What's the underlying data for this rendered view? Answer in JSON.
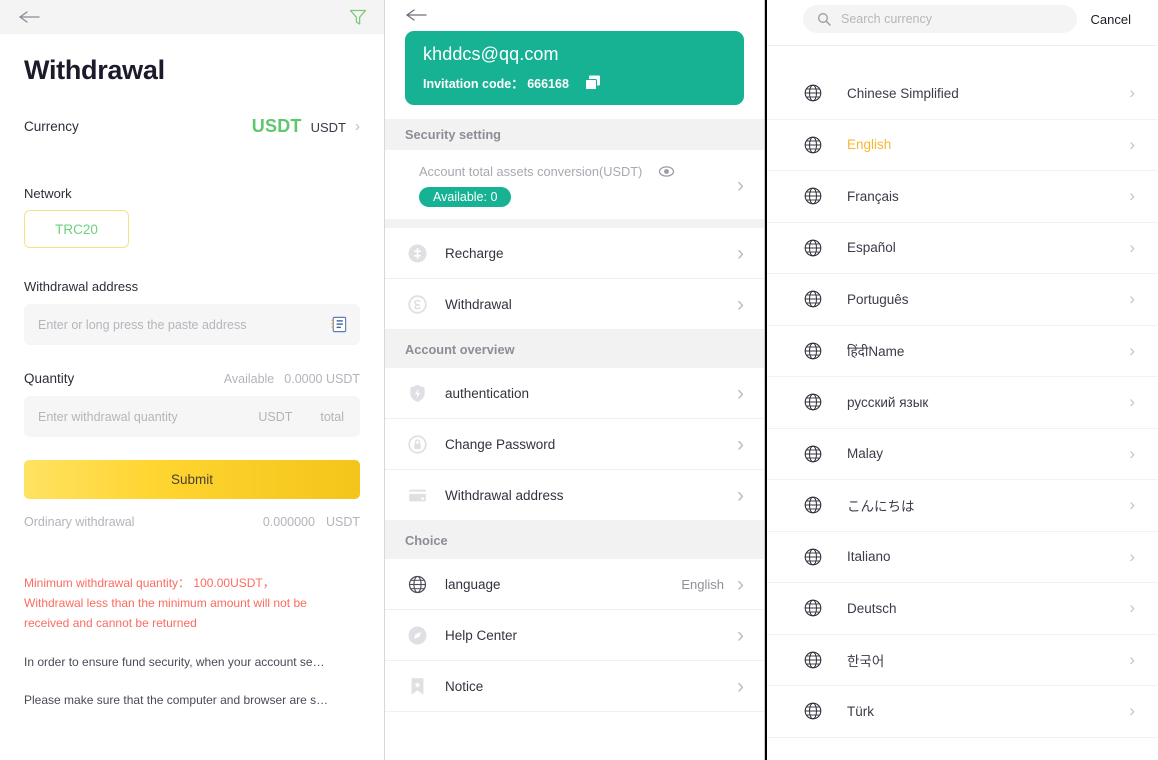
{
  "withdrawal_panel": {
    "topbar": {
      "back_icon": "back-arrow-icon",
      "filter_icon": "filter-icon"
    },
    "title": "Withdrawal",
    "currency": {
      "label": "Currency",
      "main_value": "USDT",
      "sub_value": "USDT",
      "chevron": "›"
    },
    "network": {
      "label": "Network",
      "selected": "TRC20"
    },
    "address": {
      "label": "Withdrawal address",
      "placeholder": "Enter or long press the paste address",
      "icon": "address-book-icon"
    },
    "quantity": {
      "label": "Quantity",
      "available_label": "Available",
      "available_value": "0.0000 USDT",
      "placeholder": "Enter withdrawal quantity",
      "unit": "USDT",
      "total_label": "total"
    },
    "submit_label": "Submit",
    "ordinary": {
      "label": "Ordinary withdrawal",
      "value": "0.000000",
      "unit": "USDT"
    },
    "warnings": {
      "red_line1": "Minimum withdrawal quantity： 100.00USDT，",
      "red_line2": "Withdrawal less than the minimum amount will not be",
      "red_line3": "received and cannot be returned",
      "note1": "In order to ensure fund security, when your account se…",
      "note2": "Please make sure that the computer and browser are s…"
    },
    "colors": {
      "accent_green": "#5fc86d",
      "submit_gradient_from": "#ffe262",
      "submit_gradient_to": "#f4c51a",
      "warning_red": "#fc6b5f"
    }
  },
  "account_panel": {
    "topbar": {
      "back_icon": "back-arrow-icon"
    },
    "profile": {
      "email": "khddcs@qq.com",
      "invitation_label": "Invitation code：",
      "invitation_code": "666168",
      "copy_icon": "copy-icon",
      "card_color": "#16b293"
    },
    "security_header": "Security setting",
    "assets": {
      "title": "Account total assets conversion(USDT)",
      "eye_icon": "eye-icon",
      "available_badge": "Available: 0",
      "chevron": "›"
    },
    "menu_sections": [
      {
        "header": null,
        "items": [
          {
            "label": "Recharge",
            "icon": "recharge-coin-icon",
            "value": null
          },
          {
            "label": "Withdrawal",
            "icon": "withdrawal-coin-icon",
            "value": null
          }
        ]
      },
      {
        "header": "Account overview",
        "items": [
          {
            "label": "authentication",
            "icon": "shield-icon",
            "value": null
          },
          {
            "label": "Change Password",
            "icon": "lock-icon",
            "value": null
          },
          {
            "label": "Withdrawal address",
            "icon": "card-icon",
            "value": null
          }
        ]
      },
      {
        "header": "Choice",
        "items": [
          {
            "label": "language",
            "icon": "globe-icon",
            "value": "English"
          },
          {
            "label": "Help Center",
            "icon": "compass-icon",
            "value": null
          },
          {
            "label": "Notice",
            "icon": "bookmark-star-icon",
            "value": null
          }
        ]
      }
    ]
  },
  "language_panel": {
    "search": {
      "placeholder": "Search currency",
      "icon": "search-icon",
      "cancel_label": "Cancel"
    },
    "active_language": "English",
    "languages": [
      {
        "label": "Chinese Simplified",
        "active": false
      },
      {
        "label": "English",
        "active": true
      },
      {
        "label": "Français",
        "active": false
      },
      {
        "label": "Español",
        "active": false
      },
      {
        "label": "Português",
        "active": false
      },
      {
        "label": "हिंदीName",
        "active": false
      },
      {
        "label": "русский язык",
        "active": false
      },
      {
        "label": "Malay",
        "active": false
      },
      {
        "label": "こんにちは",
        "active": false
      },
      {
        "label": "Italiano",
        "active": false
      },
      {
        "label": "Deutsch",
        "active": false
      },
      {
        "label": "한국어",
        "active": false
      },
      {
        "label": "Türk",
        "active": false
      }
    ],
    "colors": {
      "active_color": "#f7b731"
    }
  }
}
